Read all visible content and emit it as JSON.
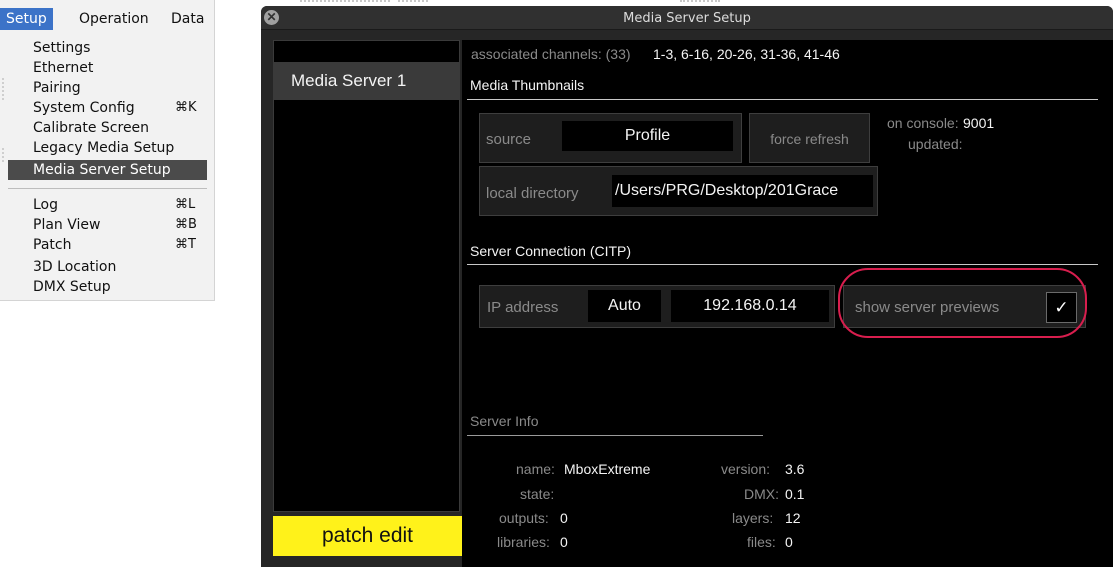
{
  "menu": {
    "bar": [
      "Setup",
      "Operation",
      "Data"
    ],
    "items_group1": [
      {
        "label": "Settings",
        "shortcut": ""
      },
      {
        "label": "Ethernet",
        "shortcut": ""
      },
      {
        "label": "Pairing",
        "shortcut": ""
      },
      {
        "label": "System Config",
        "shortcut": "⌘K"
      },
      {
        "label": "Calibrate Screen",
        "shortcut": ""
      },
      {
        "label": "Legacy Media Setup",
        "shortcut": ""
      },
      {
        "label": "Media Server Setup",
        "shortcut": "",
        "selected": true
      }
    ],
    "items_group2": [
      {
        "label": "Log",
        "shortcut": "⌘L"
      },
      {
        "label": "Plan View",
        "shortcut": "⌘B"
      },
      {
        "label": "Patch",
        "shortcut": "⌘T"
      },
      {
        "label": "3D Location",
        "shortcut": ""
      },
      {
        "label": "DMX Setup",
        "shortcut": ""
      }
    ]
  },
  "window": {
    "title": "Media Server Setup",
    "close_glyph": "✕"
  },
  "sidebar": {
    "items": [
      "Media Server 1"
    ],
    "patch_edit_label": "patch edit"
  },
  "channels": {
    "label": "associated channels: (33)",
    "value": "1-3, 6-16, 20-26, 31-36, 41-46"
  },
  "thumbnails": {
    "heading": "Media Thumbnails",
    "source_label": "source",
    "source_value": "Profile",
    "force_refresh_label": "force refresh",
    "on_console_label": "on console:",
    "on_console_value": "9001",
    "updated_label": "updated:",
    "local_dir_label": "local directory",
    "local_dir_value": "/Users/PRG/Desktop/201Grace "
  },
  "connection": {
    "heading": "Server Connection (CITP)",
    "ip_label": "IP address",
    "ip_mode": "Auto",
    "ip_value": "192.168.0.14",
    "show_previews_label": "show server previews",
    "show_previews_check": "✓",
    "show_previews_checked": true
  },
  "server_info": {
    "heading": "Server Info",
    "name_label": "name:",
    "name_value": "MboxExtreme",
    "state_label": "state:",
    "state_value": "",
    "outputs_label": "outputs:",
    "outputs_value": "0",
    "libraries_label": "libraries:",
    "libraries_value": "0",
    "version_label": "version:",
    "version_value": "3.6",
    "dmx_label": "DMX:",
    "dmx_value": "0.1",
    "layers_label": "layers:",
    "layers_value": "12",
    "files_label": "files:",
    "files_value": "0"
  },
  "colors": {
    "accent_selected": "#3c73c8",
    "patch_edit_bg": "#fff21a",
    "highlight_ring": "#d81e4e",
    "window_bg": "#000000"
  }
}
